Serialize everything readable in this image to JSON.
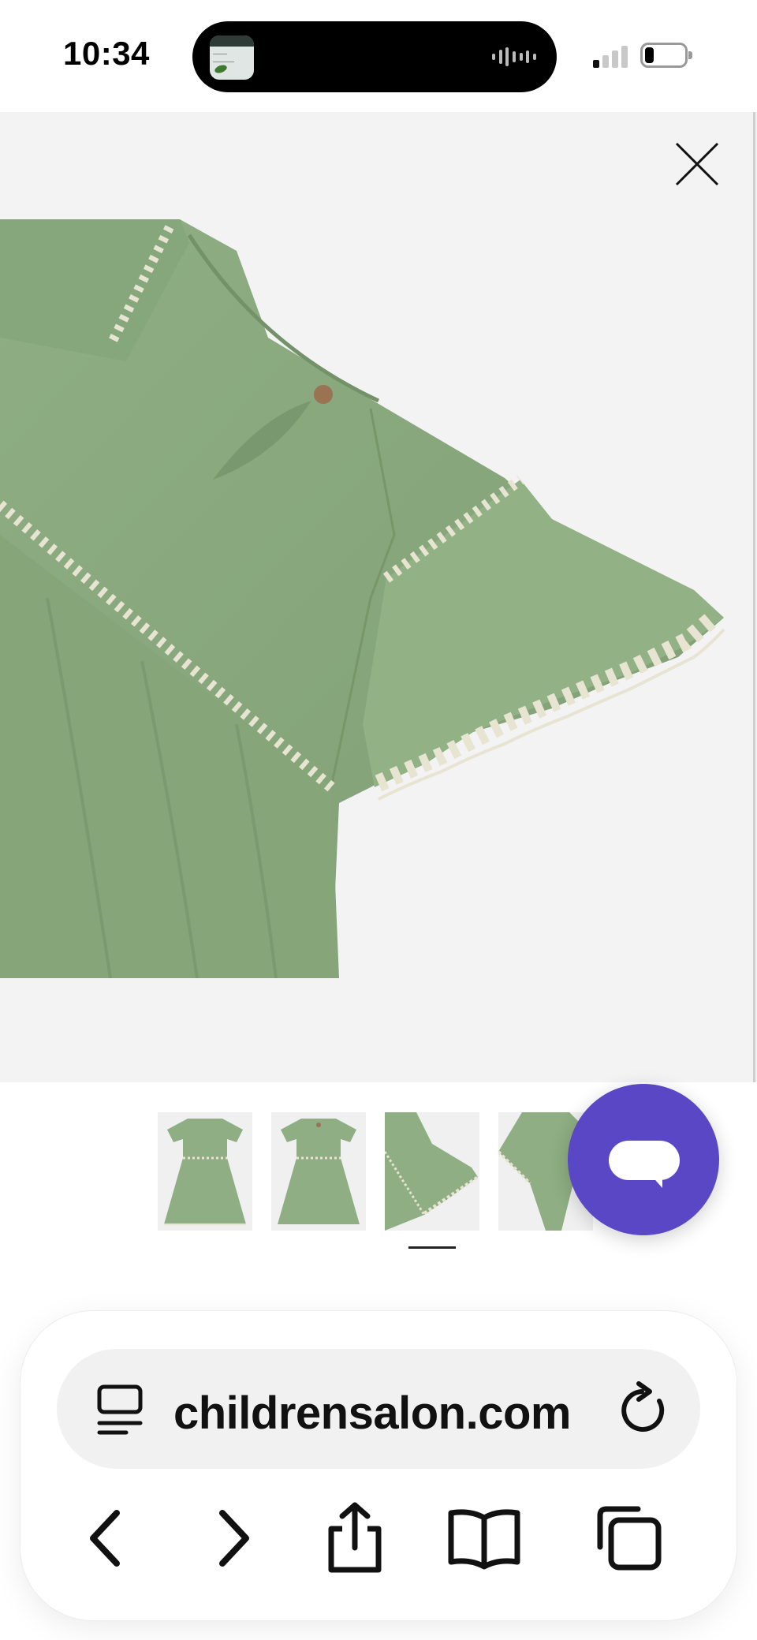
{
  "status_bar": {
    "time": "10:34",
    "live_activity_icon": "news-app-icon",
    "signal_icon": "cellular-signal-icon",
    "battery_icon": "battery-icon",
    "battery_fraction": 0.22
  },
  "viewer": {
    "close_icon": "close-icon",
    "product_image": "green-dress-closeup-photo",
    "colors": {
      "background": "#f3f3f4",
      "fabric": "#8fae83",
      "embroidery": "#e7e4d2"
    }
  },
  "thumbnails": {
    "count": 4,
    "selected_index": 2,
    "items": [
      {
        "view": "front"
      },
      {
        "view": "back"
      },
      {
        "view": "sleeve-detail"
      },
      {
        "view": "angled-detail"
      }
    ]
  },
  "chat": {
    "icon": "chat-bubble-icon",
    "color": "#5a47c6"
  },
  "browser": {
    "url": "childrensalon.com",
    "reader_icon": "page-menu-icon",
    "reload_icon": "reload-icon",
    "toolbar": [
      {
        "name": "back-button",
        "icon": "chevron-left-icon"
      },
      {
        "name": "forward-button",
        "icon": "chevron-right-icon"
      },
      {
        "name": "share-button",
        "icon": "share-icon"
      },
      {
        "name": "bookmarks-button",
        "icon": "book-icon"
      },
      {
        "name": "tabs-button",
        "icon": "tabs-icon"
      }
    ]
  }
}
